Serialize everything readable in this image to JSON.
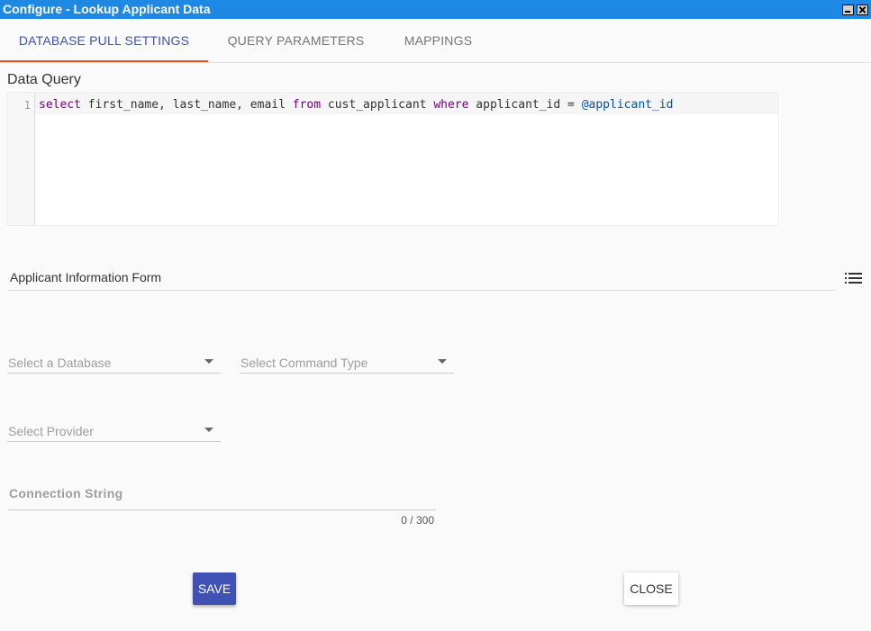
{
  "window": {
    "title": "Configure - Lookup Applicant Data",
    "controls": [
      "minimize",
      "close"
    ]
  },
  "tabs": [
    {
      "label": "DATABASE PULL SETTINGS",
      "active": true
    },
    {
      "label": "QUERY PARAMETERS",
      "active": false
    },
    {
      "label": "MAPPINGS",
      "active": false
    }
  ],
  "data_query": {
    "label": "Data Query",
    "line_number": "1",
    "tokens": {
      "t1": "select",
      "t2": " first_name, last_name, email ",
      "t3": "from",
      "t4": " cust_applicant ",
      "t5": "where",
      "t6": " applicant_id = ",
      "t7": "@applicant_id"
    }
  },
  "form": {
    "value": "Applicant Information Form",
    "icon": "list-icon"
  },
  "selects": {
    "database": "Select a Database",
    "command_type": "Select Command Type",
    "provider": "Select Provider"
  },
  "connection": {
    "placeholder": "Connection String",
    "counter": "0 / 300"
  },
  "buttons": {
    "save": "SAVE",
    "close": "CLOSE"
  },
  "colors": {
    "titlebar": "#1e88e5",
    "tab_active": "#3f51b5",
    "tab_indicator": "#e8561f",
    "save_button": "#3f51b5",
    "keyword": "#770088",
    "variable": "#0055aa"
  }
}
